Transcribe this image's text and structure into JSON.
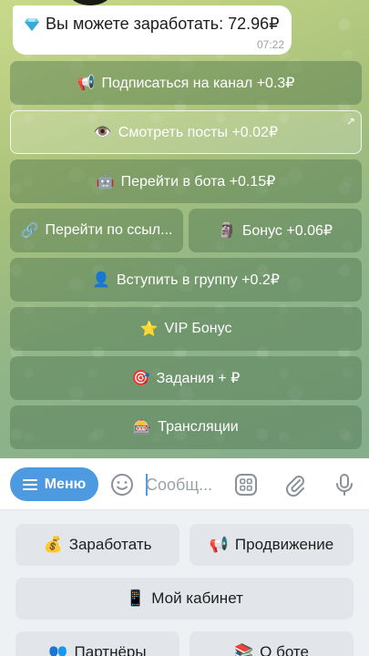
{
  "chat": {
    "message": {
      "text": "Вы можете заработать: 72.96₽",
      "time": "07:22",
      "icon": "diamond-icon"
    },
    "inline_buttons": [
      {
        "emoji": "📢",
        "label": "Подписаться на канал +0.3₽"
      },
      {
        "emoji": "👁️",
        "label": "Смотреть посты +0.02₽",
        "corner": "↗"
      },
      {
        "emoji": "🤖",
        "label": "Перейти в бота +0.15₽"
      },
      {
        "emoji": "🔗",
        "label": "Перейти по ссыл..."
      },
      {
        "emoji": "🗿",
        "label": "Бонус +0.06₽"
      },
      {
        "emoji": "👤",
        "label": "Вступить в группу +0.2₽"
      },
      {
        "emoji": "⭐",
        "label": "VIP Бонус"
      },
      {
        "emoji": "🎯",
        "label": "Задания + ₽"
      },
      {
        "emoji": "🎰",
        "label": "Трансляции"
      }
    ]
  },
  "input_bar": {
    "menu_label": "Меню",
    "placeholder": "Сообщ..."
  },
  "reply_keyboard": [
    {
      "emoji": "💰",
      "label": "Заработать"
    },
    {
      "emoji": "📢",
      "label": "Продвижение"
    },
    {
      "emoji": "📱",
      "label": "Мой кабинет"
    },
    {
      "emoji": "👥",
      "label": "Партнёры"
    },
    {
      "emoji": "📚",
      "label": "О боте"
    }
  ],
  "colors": {
    "accent": "#4d9ae0",
    "inline_button": "#4a704a",
    "chat_bg_top": "#c9d98a",
    "chat_bg_bottom": "#86ad8c"
  }
}
